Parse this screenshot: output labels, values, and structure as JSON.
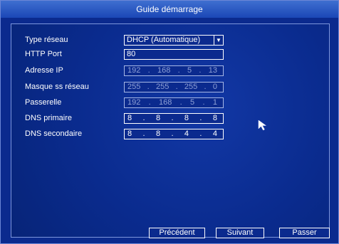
{
  "window": {
    "title": "Guide démarrage"
  },
  "form": {
    "type_reseau": {
      "label": "Type réseau",
      "value": "DHCP (Automatique)"
    },
    "http_port": {
      "label": "HTTP Port",
      "value": "80"
    },
    "adresse_ip": {
      "label": "Adresse IP",
      "octets": [
        "192",
        "168",
        "5",
        "13"
      ]
    },
    "masque": {
      "label": "Masque ss réseau",
      "octets": [
        "255",
        "255",
        "255",
        "0"
      ]
    },
    "passerelle": {
      "label": "Passerelle",
      "octets": [
        "192",
        "168",
        "5",
        "1"
      ]
    },
    "dns_primaire": {
      "label": "DNS primaire",
      "octets": [
        "8",
        "8",
        "8",
        "8"
      ]
    },
    "dns_secondaire": {
      "label": "DNS secondaire",
      "octets": [
        "8",
        "8",
        "4",
        "4"
      ]
    }
  },
  "buttons": {
    "prev": "Précédent",
    "next": "Suivant",
    "skip": "Passer"
  },
  "icons": {
    "dropdown": "chevron-down-icon",
    "cursor": "mouse-pointer-icon"
  }
}
